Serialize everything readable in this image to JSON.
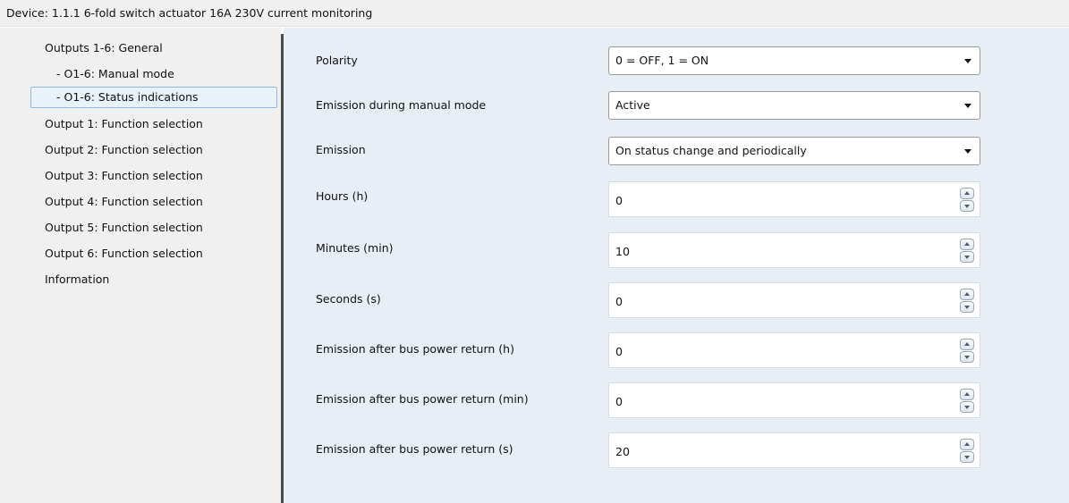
{
  "window": {
    "title": "Device: 1.1.1  6-fold switch actuator 16A 230V current monitoring"
  },
  "sidebar": {
    "items": [
      {
        "label": "Outputs 1-6: General",
        "selected": false
      },
      {
        "label": "- O1-6: Manual mode",
        "selected": false
      },
      {
        "label": "- O1-6: Status indications",
        "selected": true
      },
      {
        "label": "Output 1: Function selection",
        "selected": false
      },
      {
        "label": "Output 2: Function selection",
        "selected": false
      },
      {
        "label": "Output 3: Function selection",
        "selected": false
      },
      {
        "label": "Output 4: Function selection",
        "selected": false
      },
      {
        "label": "Output 5: Function selection",
        "selected": false
      },
      {
        "label": "Output 6: Function selection",
        "selected": false
      },
      {
        "label": "Information",
        "selected": false
      }
    ]
  },
  "params": [
    {
      "label": "Polarity",
      "type": "dropdown",
      "value": "0 = OFF, 1 = ON"
    },
    {
      "label": "Emission during manual mode",
      "type": "dropdown",
      "value": "Active"
    },
    {
      "label": "Emission",
      "type": "dropdown",
      "value": "On status change and periodically"
    },
    {
      "label": "Hours (h)",
      "type": "spinner",
      "value": "0"
    },
    {
      "label": "Minutes (min)",
      "type": "spinner",
      "value": "10"
    },
    {
      "label": "Seconds (s)",
      "type": "spinner",
      "value": "0"
    },
    {
      "label": "Emission after bus power return (h)",
      "type": "spinner",
      "value": "0"
    },
    {
      "label": "Emission after bus power return (min)",
      "type": "spinner",
      "value": "0"
    },
    {
      "label": "Emission after bus power return (s)",
      "type": "spinner",
      "value": "20"
    }
  ],
  "icons": {
    "dropdown": "chevron-down-icon",
    "spin_up": "spin-up-icon",
    "spin_down": "spin-down-icon"
  },
  "colors": {
    "panel_bg": "#e8eef5",
    "sidebar_bg": "#f0f0f0",
    "selection_border": "#8fb8dc",
    "selection_bg": "#e9f1f9"
  }
}
